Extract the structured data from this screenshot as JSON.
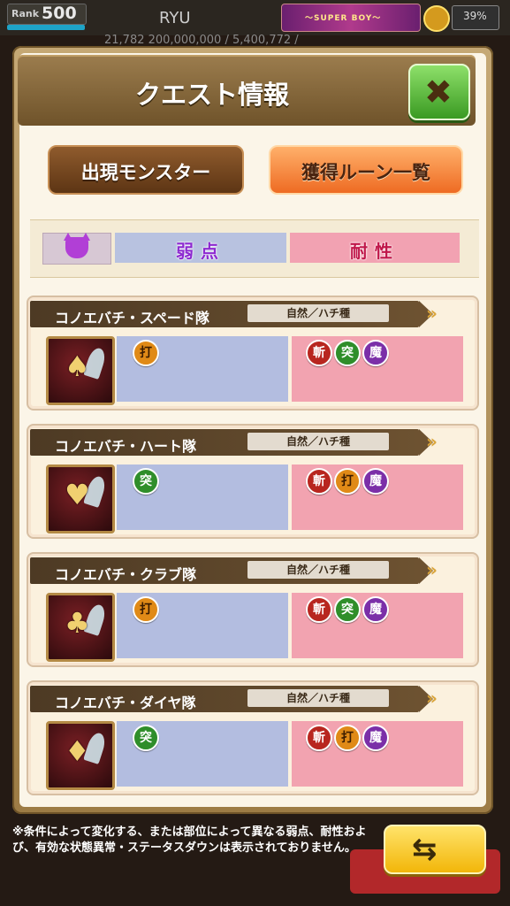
{
  "hud": {
    "rank_label": "Rank",
    "rank_value": "500",
    "player_name": "RYU",
    "banner_text": "〜SUPER BOY〜",
    "battery": "39%",
    "resources_line": "21,782  200,000,000 / 5,400,772 /"
  },
  "dialog": {
    "title": "クエスト情報",
    "close_label": "✖",
    "tabs": [
      {
        "label": "出現モンスター"
      },
      {
        "label": "獲得ルーン一覧"
      }
    ],
    "legend": {
      "weak_label": "弱点",
      "resist_label": "耐性"
    },
    "monsters": [
      {
        "name": "コノエバチ・スペード隊",
        "type": "自然／ハチ種",
        "portrait_glyph": "♠",
        "weak": [
          {
            "label": "打",
            "kind": "strike"
          }
        ],
        "resist": [
          {
            "label": "斬",
            "kind": "slash"
          },
          {
            "label": "突",
            "kind": "pierce"
          },
          {
            "label": "魔",
            "kind": "magic"
          }
        ]
      },
      {
        "name": "コノエバチ・ハート隊",
        "type": "自然／ハチ種",
        "portrait_glyph": "♥",
        "weak": [
          {
            "label": "突",
            "kind": "pierce"
          }
        ],
        "resist": [
          {
            "label": "斬",
            "kind": "slash"
          },
          {
            "label": "打",
            "kind": "strike"
          },
          {
            "label": "魔",
            "kind": "magic"
          }
        ]
      },
      {
        "name": "コノエバチ・クラブ隊",
        "type": "自然／ハチ種",
        "portrait_glyph": "♣",
        "weak": [
          {
            "label": "打",
            "kind": "strike"
          }
        ],
        "resist": [
          {
            "label": "斬",
            "kind": "slash"
          },
          {
            "label": "突",
            "kind": "pierce"
          },
          {
            "label": "魔",
            "kind": "magic"
          }
        ]
      },
      {
        "name": "コノエバチ・ダイヤ隊",
        "type": "自然／ハチ種",
        "portrait_glyph": "♦",
        "weak": [
          {
            "label": "突",
            "kind": "pierce"
          }
        ],
        "resist": [
          {
            "label": "斬",
            "kind": "slash"
          },
          {
            "label": "打",
            "kind": "strike"
          },
          {
            "label": "魔",
            "kind": "magic"
          }
        ]
      }
    ],
    "footnote": "※条件によって変化する、または部位によって異なる弱点、耐性および、有効な状態異常・ステータスダウンは表示されておりません。"
  },
  "colors": {
    "weak_bg": "#b3bde0",
    "resist_bg": "#f2a3b0",
    "close_green": "#3a9a22",
    "tab_active": "#ee6b23"
  },
  "icons": {
    "close": "close-icon",
    "swap": "swap-arrows-icon",
    "demon": "demon-face-icon"
  }
}
